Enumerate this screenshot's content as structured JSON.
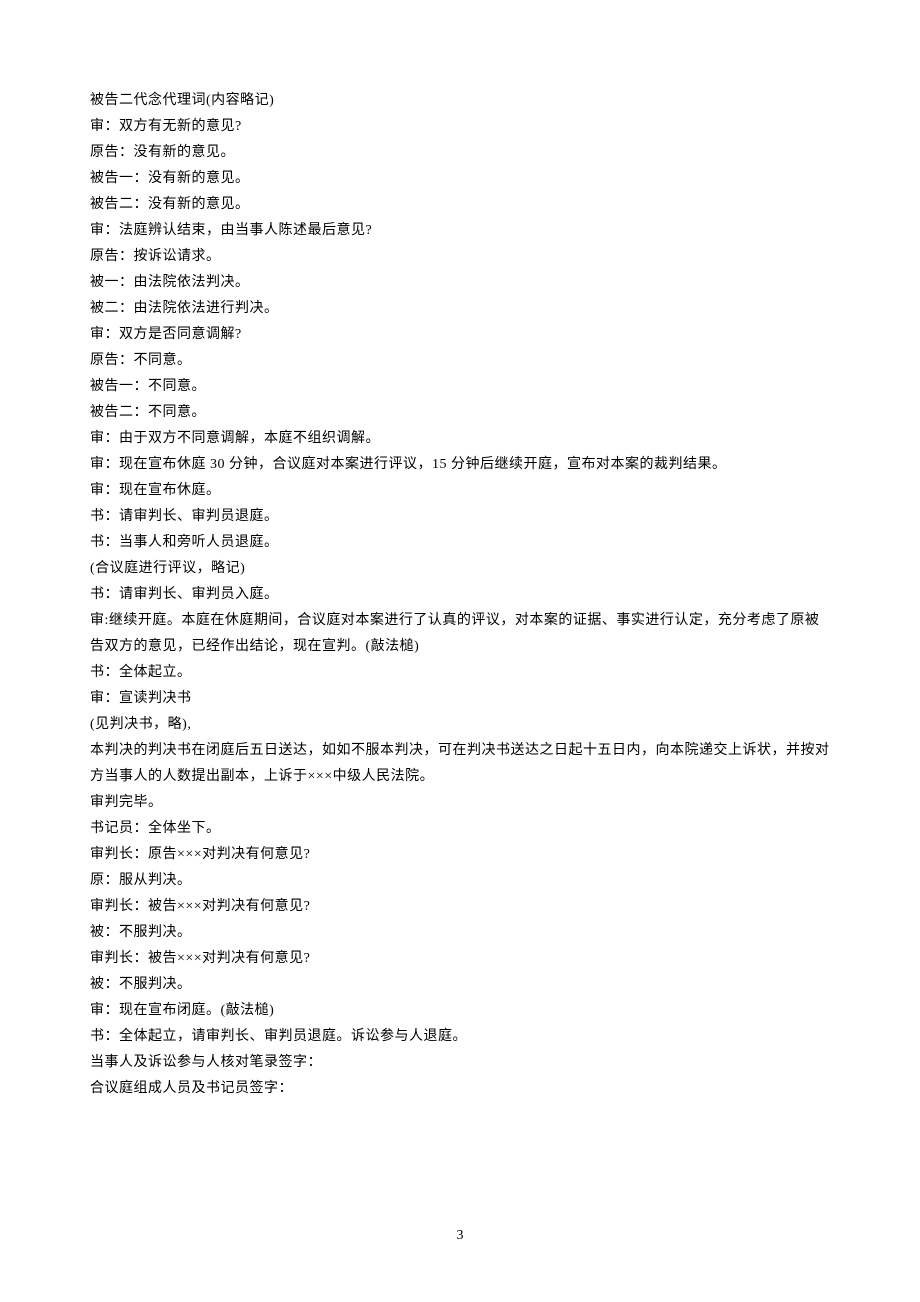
{
  "lines": [
    "被告二代念代理词(内容略记)",
    "审：双方有无新的意见?",
    "原告：没有新的意见。",
    "被告一：没有新的意见。",
    "被告二：没有新的意见。",
    "审：法庭辨认结束，由当事人陈述最后意见?",
    "原告：按诉讼请求。",
    "被一：由法院依法判决。",
    "被二：由法院依法进行判决。",
    "审：双方是否同意调解?",
    "原告：不同意。",
    "被告一：不同意。",
    "被告二：不同意。",
    "审：由于双方不同意调解，本庭不组织调解。",
    "审：现在宣布休庭 30 分钟，合议庭对本案进行评议，15 分钟后继续开庭，宣布对本案的裁判结果。",
    "审：现在宣布休庭。",
    "书：请审判长、审判员退庭。",
    "书：当事人和旁听人员退庭。",
    "(合议庭进行评议，略记)",
    "书：请审判长、审判员入庭。",
    "审:继续开庭。本庭在休庭期间，合议庭对本案进行了认真的评议，对本案的证据、事实进行认定，充分考虑了原被告双方的意见，已经作出结论，现在宣判。(敲法槌)",
    "书：全体起立。",
    "审：宣读判决书",
    "(见判决书，略),",
    "本判决的判决书在闭庭后五日送达，如如不服本判决，可在判决书送达之日起十五日内，向本院递交上诉状，并按对方当事人的人数提出副本，上诉于×××中级人民法院。",
    "审判完毕。",
    "书记员：全体坐下。",
    "审判长：原告×××对判决有何意见?",
    "原：服从判决。",
    "审判长：被告×××对判决有何意见?",
    "被：不服判决。",
    "审判长：被告×××对判决有何意见?",
    "被：不服判决。",
    "审：现在宣布闭庭。(敲法槌)",
    "书：全体起立，请审判长、审判员退庭。诉讼参与人退庭。",
    "当事人及诉讼参与人核对笔录签字：",
    "合议庭组成人员及书记员签字："
  ],
  "page_number": "3"
}
